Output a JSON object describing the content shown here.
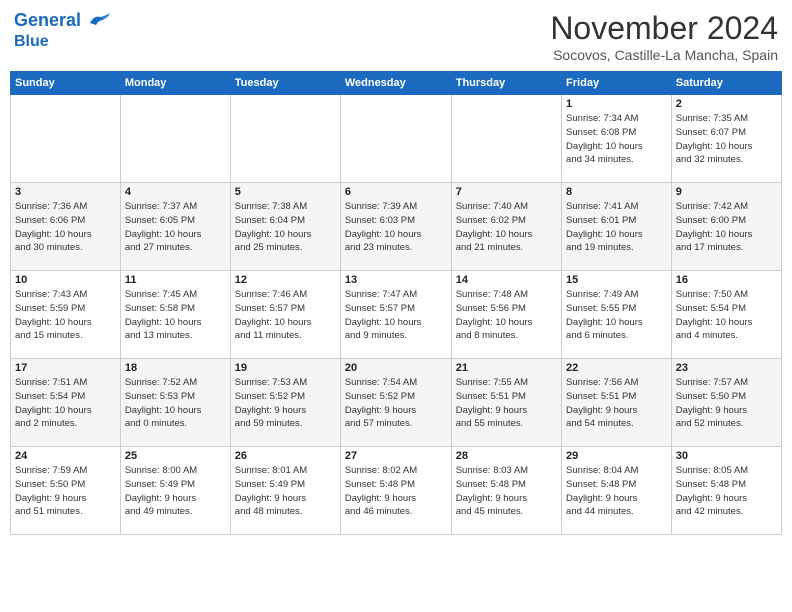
{
  "header": {
    "logo_line1": "General",
    "logo_line2": "Blue",
    "month_title": "November 2024",
    "subtitle": "Socovos, Castille-La Mancha, Spain"
  },
  "weekdays": [
    "Sunday",
    "Monday",
    "Tuesday",
    "Wednesday",
    "Thursday",
    "Friday",
    "Saturday"
  ],
  "weeks": [
    [
      {
        "day": "",
        "info": ""
      },
      {
        "day": "",
        "info": ""
      },
      {
        "day": "",
        "info": ""
      },
      {
        "day": "",
        "info": ""
      },
      {
        "day": "",
        "info": ""
      },
      {
        "day": "1",
        "info": "Sunrise: 7:34 AM\nSunset: 6:08 PM\nDaylight: 10 hours\nand 34 minutes."
      },
      {
        "day": "2",
        "info": "Sunrise: 7:35 AM\nSunset: 6:07 PM\nDaylight: 10 hours\nand 32 minutes."
      }
    ],
    [
      {
        "day": "3",
        "info": "Sunrise: 7:36 AM\nSunset: 6:06 PM\nDaylight: 10 hours\nand 30 minutes."
      },
      {
        "day": "4",
        "info": "Sunrise: 7:37 AM\nSunset: 6:05 PM\nDaylight: 10 hours\nand 27 minutes."
      },
      {
        "day": "5",
        "info": "Sunrise: 7:38 AM\nSunset: 6:04 PM\nDaylight: 10 hours\nand 25 minutes."
      },
      {
        "day": "6",
        "info": "Sunrise: 7:39 AM\nSunset: 6:03 PM\nDaylight: 10 hours\nand 23 minutes."
      },
      {
        "day": "7",
        "info": "Sunrise: 7:40 AM\nSunset: 6:02 PM\nDaylight: 10 hours\nand 21 minutes."
      },
      {
        "day": "8",
        "info": "Sunrise: 7:41 AM\nSunset: 6:01 PM\nDaylight: 10 hours\nand 19 minutes."
      },
      {
        "day": "9",
        "info": "Sunrise: 7:42 AM\nSunset: 6:00 PM\nDaylight: 10 hours\nand 17 minutes."
      }
    ],
    [
      {
        "day": "10",
        "info": "Sunrise: 7:43 AM\nSunset: 5:59 PM\nDaylight: 10 hours\nand 15 minutes."
      },
      {
        "day": "11",
        "info": "Sunrise: 7:45 AM\nSunset: 5:58 PM\nDaylight: 10 hours\nand 13 minutes."
      },
      {
        "day": "12",
        "info": "Sunrise: 7:46 AM\nSunset: 5:57 PM\nDaylight: 10 hours\nand 11 minutes."
      },
      {
        "day": "13",
        "info": "Sunrise: 7:47 AM\nSunset: 5:57 PM\nDaylight: 10 hours\nand 9 minutes."
      },
      {
        "day": "14",
        "info": "Sunrise: 7:48 AM\nSunset: 5:56 PM\nDaylight: 10 hours\nand 8 minutes."
      },
      {
        "day": "15",
        "info": "Sunrise: 7:49 AM\nSunset: 5:55 PM\nDaylight: 10 hours\nand 6 minutes."
      },
      {
        "day": "16",
        "info": "Sunrise: 7:50 AM\nSunset: 5:54 PM\nDaylight: 10 hours\nand 4 minutes."
      }
    ],
    [
      {
        "day": "17",
        "info": "Sunrise: 7:51 AM\nSunset: 5:54 PM\nDaylight: 10 hours\nand 2 minutes."
      },
      {
        "day": "18",
        "info": "Sunrise: 7:52 AM\nSunset: 5:53 PM\nDaylight: 10 hours\nand 0 minutes."
      },
      {
        "day": "19",
        "info": "Sunrise: 7:53 AM\nSunset: 5:52 PM\nDaylight: 9 hours\nand 59 minutes."
      },
      {
        "day": "20",
        "info": "Sunrise: 7:54 AM\nSunset: 5:52 PM\nDaylight: 9 hours\nand 57 minutes."
      },
      {
        "day": "21",
        "info": "Sunrise: 7:55 AM\nSunset: 5:51 PM\nDaylight: 9 hours\nand 55 minutes."
      },
      {
        "day": "22",
        "info": "Sunrise: 7:56 AM\nSunset: 5:51 PM\nDaylight: 9 hours\nand 54 minutes."
      },
      {
        "day": "23",
        "info": "Sunrise: 7:57 AM\nSunset: 5:50 PM\nDaylight: 9 hours\nand 52 minutes."
      }
    ],
    [
      {
        "day": "24",
        "info": "Sunrise: 7:59 AM\nSunset: 5:50 PM\nDaylight: 9 hours\nand 51 minutes."
      },
      {
        "day": "25",
        "info": "Sunrise: 8:00 AM\nSunset: 5:49 PM\nDaylight: 9 hours\nand 49 minutes."
      },
      {
        "day": "26",
        "info": "Sunrise: 8:01 AM\nSunset: 5:49 PM\nDaylight: 9 hours\nand 48 minutes."
      },
      {
        "day": "27",
        "info": "Sunrise: 8:02 AM\nSunset: 5:48 PM\nDaylight: 9 hours\nand 46 minutes."
      },
      {
        "day": "28",
        "info": "Sunrise: 8:03 AM\nSunset: 5:48 PM\nDaylight: 9 hours\nand 45 minutes."
      },
      {
        "day": "29",
        "info": "Sunrise: 8:04 AM\nSunset: 5:48 PM\nDaylight: 9 hours\nand 44 minutes."
      },
      {
        "day": "30",
        "info": "Sunrise: 8:05 AM\nSunset: 5:48 PM\nDaylight: 9 hours\nand 42 minutes."
      }
    ]
  ]
}
